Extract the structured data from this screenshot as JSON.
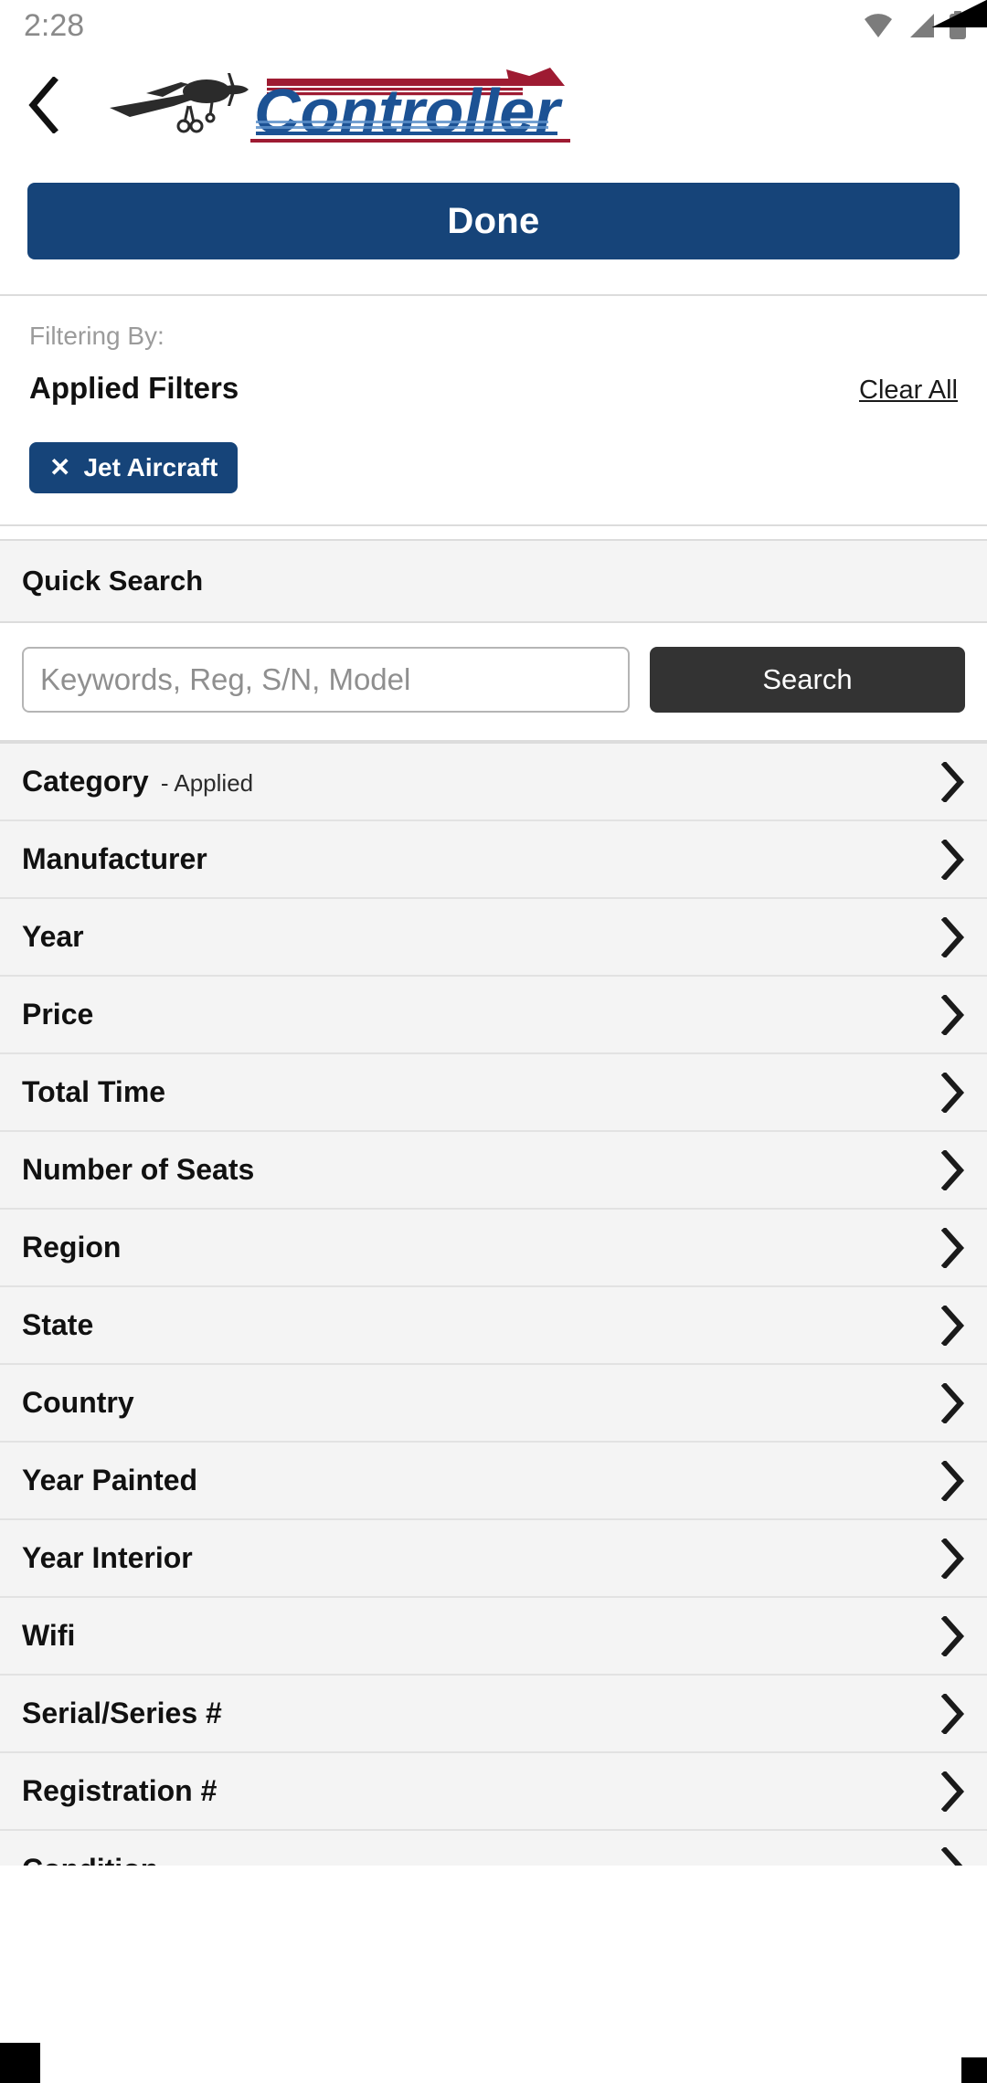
{
  "status_bar": {
    "time": "2:28",
    "icons": [
      "wifi-icon",
      "cellular-signal-icon",
      "battery-icon"
    ],
    "icon_color": "#7c7c7c"
  },
  "header": {
    "back_icon": "back-chevron-icon",
    "logo_text": "Controller",
    "logo_blue": "#1c5294",
    "logo_red": "#9e1b32",
    "plane_icon": "airplane-icon"
  },
  "done_button": {
    "label": "Done",
    "background": "#164479",
    "text_color": "#ffffff"
  },
  "applied_filters": {
    "filtering_by_label": "Filtering By:",
    "title": "Applied Filters",
    "clear_all_label": "Clear All",
    "chips": [
      {
        "label": "Jet Aircraft",
        "remove_icon": "close-x-icon",
        "background": "#164479"
      }
    ]
  },
  "quick_search": {
    "title": "Quick Search",
    "input_placeholder": "Keywords, Reg, S/N, Model",
    "input_value": "",
    "search_button_label": "Search",
    "search_button_background": "#333333"
  },
  "filter_rows": [
    {
      "label": "Category",
      "suffix": " - Applied"
    },
    {
      "label": "Manufacturer",
      "suffix": ""
    },
    {
      "label": "Year",
      "suffix": ""
    },
    {
      "label": "Price",
      "suffix": ""
    },
    {
      "label": "Total Time",
      "suffix": ""
    },
    {
      "label": "Number of Seats",
      "suffix": ""
    },
    {
      "label": "Region",
      "suffix": ""
    },
    {
      "label": "State",
      "suffix": ""
    },
    {
      "label": "Country",
      "suffix": ""
    },
    {
      "label": "Year Painted",
      "suffix": ""
    },
    {
      "label": "Year Interior",
      "suffix": ""
    },
    {
      "label": "Wifi",
      "suffix": ""
    },
    {
      "label": "Serial/Series #",
      "suffix": ""
    },
    {
      "label": "Registration #",
      "suffix": ""
    },
    {
      "label": "Condition",
      "suffix": ""
    }
  ],
  "icons": {
    "row_chevron": "chevron-right-icon"
  }
}
